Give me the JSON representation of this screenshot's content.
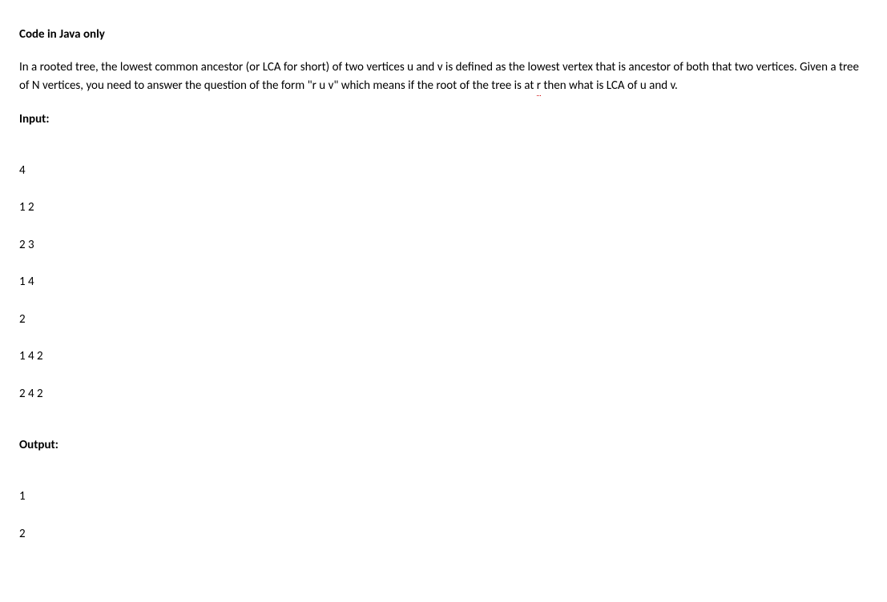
{
  "title": "Code in Java only",
  "description_part1": "In a rooted tree, the lowest common ancestor (or LCA for short) of two vertices u and v is defined as the lowest vertex that is ancestor of both that two vertices. Given a tree of N vertices, you need to answer the question of the form \"r u v\" which means if the root of the tree is at ",
  "description_r": "r",
  "description_part2": " then what is LCA of u and v.",
  "input_label": "Input:",
  "input_lines": [
    "4",
    "1 2",
    "2 3",
    "1 4",
    "2",
    "1 4 2",
    "2 4 2"
  ],
  "output_label": "Output:",
  "output_lines": [
    "1",
    "2"
  ]
}
